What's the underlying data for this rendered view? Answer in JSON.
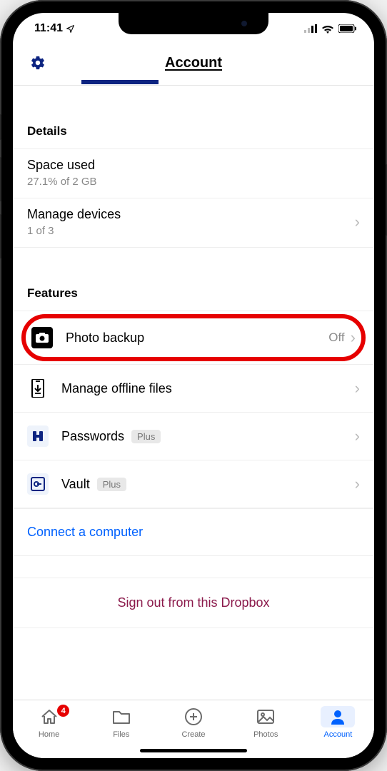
{
  "status": {
    "time": "11:41",
    "location_icon": "location-arrow"
  },
  "header": {
    "settings_icon": "gear-icon",
    "title": "Account"
  },
  "sections": {
    "details": {
      "title": "Details",
      "space_used": {
        "label": "Space used",
        "value": "27.1% of 2 GB"
      },
      "manage_devices": {
        "label": "Manage devices",
        "value": "1 of 3"
      }
    },
    "features": {
      "title": "Features",
      "photo_backup": {
        "label": "Photo backup",
        "value": "Off"
      },
      "offline": {
        "label": "Manage offline files"
      },
      "passwords": {
        "label": "Passwords",
        "badge": "Plus"
      },
      "vault": {
        "label": "Vault",
        "badge": "Plus"
      }
    },
    "connect": {
      "label": "Connect a computer"
    },
    "signout": {
      "label": "Sign out from this Dropbox"
    }
  },
  "tabs": {
    "home": {
      "label": "Home",
      "badge": "4"
    },
    "files": {
      "label": "Files"
    },
    "create": {
      "label": "Create"
    },
    "photos": {
      "label": "Photos"
    },
    "account": {
      "label": "Account"
    }
  }
}
